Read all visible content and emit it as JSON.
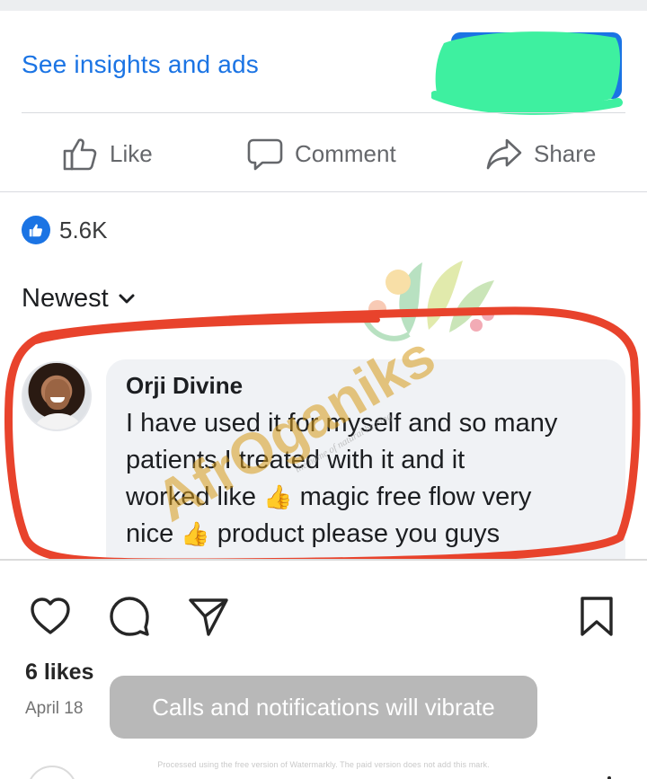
{
  "facebook_post": {
    "insights_link": "See insights and ads",
    "actions": {
      "like": "Like",
      "comment": "Comment",
      "share": "Share"
    },
    "reaction_count": "5.6K",
    "sort_label": "Newest",
    "comment": {
      "author": "Orji Divine",
      "line1": "I have used it for myself and so many",
      "line2": "patients I treated with it and it",
      "line3_a": "worked like",
      "line3_b": "magic free flow very",
      "line4_a": "nice",
      "line4_b": "product please you guys"
    }
  },
  "watermark": {
    "brand": "AfrOganiks",
    "tagline": "the home of natural healing"
  },
  "instagram": {
    "likes": "6 likes",
    "date": "April 18",
    "toast": "Calls and notifications will vibrate",
    "footer_note": "Processed using the free version of Watermarkly. The paid version does not add this mark."
  },
  "colors": {
    "link_blue": "#1b74e4",
    "annotation_red": "#e8432c",
    "redaction_green": "#3ef0a0",
    "toast_gray": "#b8b8b8"
  }
}
